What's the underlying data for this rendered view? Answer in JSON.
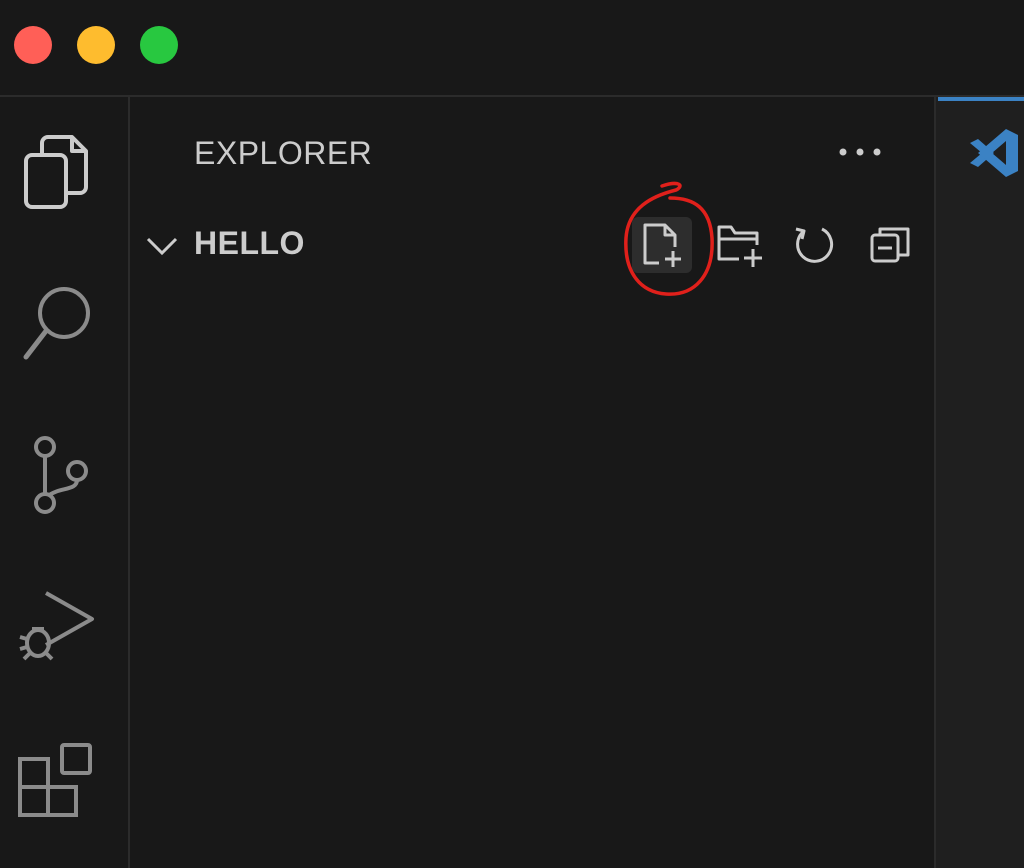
{
  "colors": {
    "close": "#ff5f57",
    "minimize": "#febc2e",
    "maximize": "#28c840",
    "icon": "#cccccc",
    "activity_icon": "#8b8b8b",
    "annotation": "#e0201b",
    "logo_blue": "#3b82c4"
  },
  "window_controls": {
    "close": "close",
    "minimize": "minimize",
    "maximize": "maximize"
  },
  "activity_bar": {
    "items": [
      {
        "icon": "files-icon",
        "active": true
      },
      {
        "icon": "search-icon",
        "active": false
      },
      {
        "icon": "source-control-icon",
        "active": false
      },
      {
        "icon": "run-debug-icon",
        "active": false
      },
      {
        "icon": "extensions-icon",
        "active": false
      }
    ]
  },
  "sidebar": {
    "title": "EXPLORER",
    "more_actions": "...",
    "section": {
      "name": "HELLO",
      "expanded": true,
      "actions": [
        {
          "icon": "new-file-icon",
          "highlighted": true
        },
        {
          "icon": "new-folder-icon",
          "highlighted": false
        },
        {
          "icon": "refresh-icon",
          "highlighted": false
        },
        {
          "icon": "collapse-all-icon",
          "highlighted": false
        }
      ]
    }
  },
  "editor": {
    "logo": "vscode-logo"
  }
}
